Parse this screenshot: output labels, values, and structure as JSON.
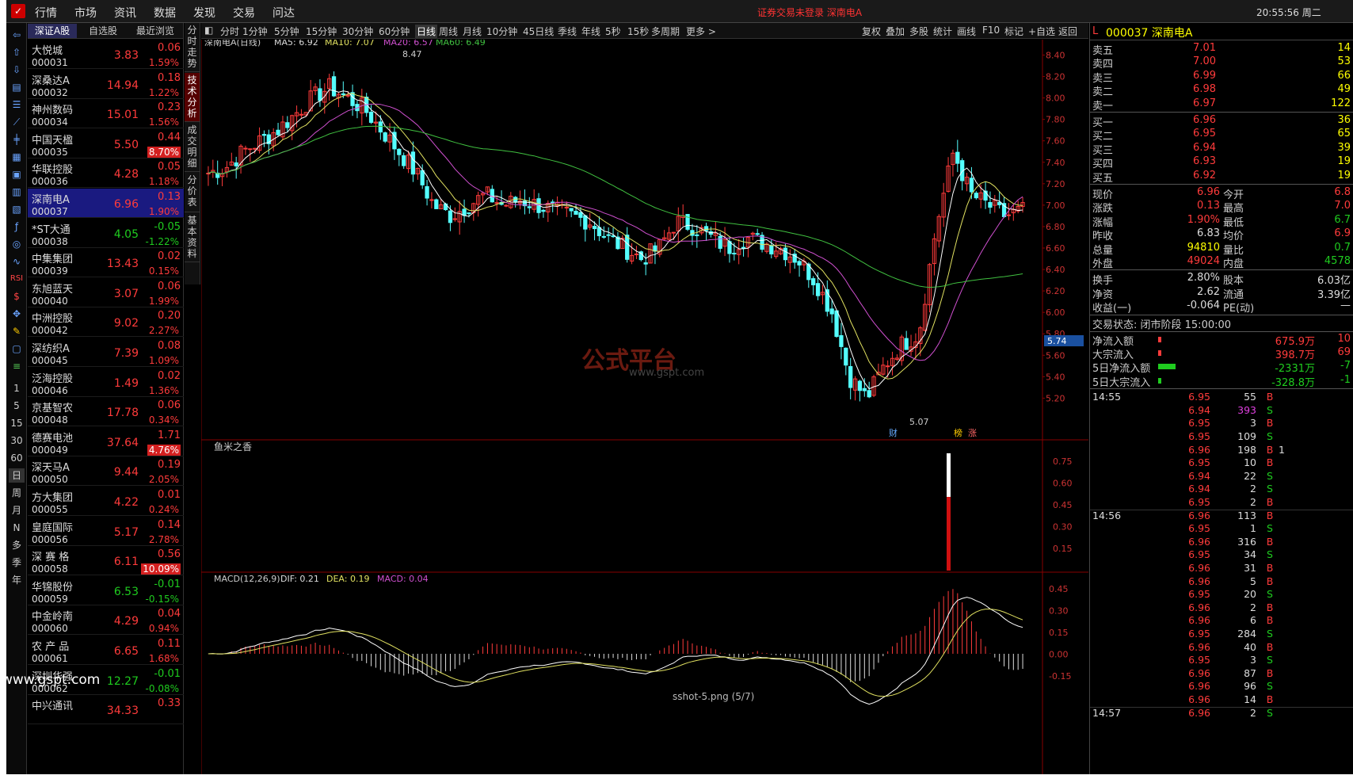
{
  "menubar": {
    "items": [
      "行情",
      "市场",
      "资讯",
      "数据",
      "发现",
      "交易",
      "问达"
    ],
    "warning": "证券交易未登录 深南电A",
    "clock": "20:55:56 周二"
  },
  "left_toolbar": {
    "periods": [
      "1",
      "5",
      "15",
      "30",
      "60",
      "日",
      "周",
      "月",
      "N",
      "多",
      "季",
      "年"
    ]
  },
  "stocklist": {
    "tabs": [
      "深证A股",
      "自选股",
      "最近浏览"
    ],
    "rows": [
      {
        "name": "大悦城",
        "code": "000031",
        "price": "3.83",
        "change": "0.06",
        "pct": "1.59%",
        "dir": "up",
        "hl": false
      },
      {
        "name": "深桑达A",
        "code": "000032",
        "price": "14.94",
        "change": "0.18",
        "pct": "1.22%",
        "dir": "up",
        "hl": false
      },
      {
        "name": "神州数码",
        "code": "000034",
        "price": "15.01",
        "change": "0.23",
        "pct": "1.56%",
        "dir": "up",
        "hl": false
      },
      {
        "name": "中国天楹",
        "code": "000035",
        "price": "5.50",
        "change": "0.44",
        "pct": "8.70%",
        "dir": "up",
        "hl": true
      },
      {
        "name": "华联控股",
        "code": "000036",
        "price": "4.28",
        "change": "0.05",
        "pct": "1.18%",
        "dir": "up",
        "hl": false
      },
      {
        "name": "深南电A",
        "code": "000037",
        "price": "6.96",
        "change": "0.13",
        "pct": "1.90%",
        "dir": "up",
        "hl": false,
        "sel": true
      },
      {
        "name": "*ST大通",
        "code": "000038",
        "price": "4.05",
        "change": "-0.05",
        "pct": "-1.22%",
        "dir": "dn",
        "hl": false
      },
      {
        "name": "中集集团",
        "code": "000039",
        "price": "13.43",
        "change": "0.02",
        "pct": "0.15%",
        "dir": "up",
        "hl": false
      },
      {
        "name": "东旭蓝天",
        "code": "000040",
        "price": "3.07",
        "change": "0.06",
        "pct": "1.99%",
        "dir": "up",
        "hl": false
      },
      {
        "name": "中洲控股",
        "code": "000042",
        "price": "9.02",
        "change": "0.20",
        "pct": "2.27%",
        "dir": "up",
        "hl": false
      },
      {
        "name": "深纺织A",
        "code": "000045",
        "price": "7.39",
        "change": "0.08",
        "pct": "1.09%",
        "dir": "up",
        "hl": false
      },
      {
        "name": "泛海控股",
        "code": "000046",
        "price": "1.49",
        "change": "0.02",
        "pct": "1.36%",
        "dir": "up",
        "hl": false
      },
      {
        "name": "京基智农",
        "code": "000048",
        "price": "17.78",
        "change": "0.06",
        "pct": "0.34%",
        "dir": "up",
        "hl": false
      },
      {
        "name": "德赛电池",
        "code": "000049",
        "price": "37.64",
        "change": "1.71",
        "pct": "4.76%",
        "dir": "up",
        "hl": true
      },
      {
        "name": "深天马A",
        "code": "000050",
        "price": "9.44",
        "change": "0.19",
        "pct": "2.05%",
        "dir": "up",
        "hl": false
      },
      {
        "name": "方大集团",
        "code": "000055",
        "price": "4.22",
        "change": "0.01",
        "pct": "0.24%",
        "dir": "up",
        "hl": false
      },
      {
        "name": "皇庭国际",
        "code": "000056",
        "price": "5.17",
        "change": "0.14",
        "pct": "2.78%",
        "dir": "up",
        "hl": false
      },
      {
        "name": "深 赛 格",
        "code": "000058",
        "price": "6.11",
        "change": "0.56",
        "pct": "10.09%",
        "dir": "up",
        "hl": true
      },
      {
        "name": "华锦股份",
        "code": "000059",
        "price": "6.53",
        "change": "-0.01",
        "pct": "-0.15%",
        "dir": "dn",
        "hl": false
      },
      {
        "name": "中金岭南",
        "code": "000060",
        "price": "4.29",
        "change": "0.04",
        "pct": "0.94%",
        "dir": "up",
        "hl": false
      },
      {
        "name": "农 产 品",
        "code": "000061",
        "price": "6.65",
        "change": "0.11",
        "pct": "1.68%",
        "dir": "up",
        "hl": false
      },
      {
        "name": "深圳华强",
        "code": "000062",
        "price": "12.27",
        "change": "-0.01",
        "pct": "-0.08%",
        "dir": "dn",
        "hl": false
      },
      {
        "name": "中兴通讯",
        "code": "",
        "price": "34.33",
        "change": "0.33",
        "pct": "",
        "dir": "up",
        "hl": false
      }
    ]
  },
  "vtabs": [
    "分时走势",
    "技术分析",
    "成交明细",
    "分价表",
    "基本资料"
  ],
  "chart_toolbar": {
    "periods": [
      "分时",
      "1分钟",
      "5分钟",
      "15分钟",
      "30分钟",
      "60分钟",
      "日线",
      "周线",
      "月线",
      "10分钟",
      "45日线",
      "季线",
      "年线",
      "5秒",
      "15秒",
      "多周期",
      "更多 >"
    ],
    "active": "日线",
    "right_buttons": [
      "复权",
      "叠加",
      "多股",
      "统计",
      "画线",
      "F10",
      "标记",
      "+自选",
      "返回"
    ]
  },
  "kline": {
    "legend_title": "深南电A(日线)",
    "ma5": "MA5: 6.92",
    "ma10": "MA10: 7.07",
    "ma20": "MA20: 6.57",
    "ma60": "MA60: 6.49",
    "high_label": "8.47",
    "low_label": "5.07",
    "price_tag": "5.74",
    "marks": [
      "财",
      "榜",
      "涨"
    ],
    "y_ticks": [
      "8.40",
      "8.20",
      "8.00",
      "7.80",
      "7.60",
      "7.40",
      "7.20",
      "7.00",
      "6.80",
      "6.60",
      "6.40",
      "6.20",
      "6.00",
      "5.80",
      "5.60",
      "5.40",
      "5.20"
    ],
    "colors": {
      "up": "#ff3b3b",
      "down": "#54ffff",
      "ma5": "#ffffff",
      "ma10": "#e0e060",
      "ma20": "#d050d0",
      "ma60": "#40c040"
    }
  },
  "indicator1": {
    "title": "鱼米之香",
    "y_ticks": [
      "0.75",
      "0.60",
      "0.45",
      "0.30",
      "0.15"
    ]
  },
  "macd": {
    "title": "MACD(12,26,9)",
    "dif": "DIF: 0.21",
    "dea": "DEA: 0.19",
    "macd": "MACD: 0.04",
    "y_ticks": [
      "0.45",
      "0.30",
      "0.15",
      "0.00",
      "-0.15"
    ]
  },
  "watermarks": {
    "logo_main": "公式平台",
    "logo_sub": "www.gspt.com",
    "caption": "sshot-5.png (5/7)",
    "left_wm": "www.gspt.com"
  },
  "quote": {
    "code": "000037",
    "name": "深南电A",
    "asks": [
      {
        "label": "卖五",
        "price": "7.01",
        "vol": "14"
      },
      {
        "label": "卖四",
        "price": "7.00",
        "vol": "53"
      },
      {
        "label": "卖三",
        "price": "6.99",
        "vol": "66"
      },
      {
        "label": "卖二",
        "price": "6.98",
        "vol": "49"
      },
      {
        "label": "卖一",
        "price": "6.97",
        "vol": "122"
      }
    ],
    "bids": [
      {
        "label": "买一",
        "price": "6.96",
        "vol": "36"
      },
      {
        "label": "买二",
        "price": "6.95",
        "vol": "65"
      },
      {
        "label": "买三",
        "price": "6.94",
        "vol": "39"
      },
      {
        "label": "买四",
        "price": "6.93",
        "vol": "19"
      },
      {
        "label": "买五",
        "price": "6.92",
        "vol": "19"
      }
    ],
    "stats": [
      {
        "k1": "现价",
        "v1": "6.96",
        "c1": "up",
        "k2": "今开",
        "v2": "6.8",
        "c2": "up"
      },
      {
        "k1": "涨跌",
        "v1": "0.13",
        "c1": "up",
        "k2": "最高",
        "v2": "7.0",
        "c2": "up"
      },
      {
        "k1": "涨幅",
        "v1": "1.90%",
        "c1": "up",
        "k2": "最低",
        "v2": "6.7",
        "c2": "dn"
      },
      {
        "k1": "昨收",
        "v1": "6.83",
        "c1": "wh",
        "k2": "均价",
        "v2": "6.9",
        "c2": "up"
      },
      {
        "k1": "总量",
        "v1": "94810",
        "c1": "yl",
        "k2": "量比",
        "v2": "0.7",
        "c2": "dn"
      },
      {
        "k1": "外盘",
        "v1": "49024",
        "c1": "up",
        "k2": "内盘",
        "v2": "4578",
        "c2": "dn"
      }
    ],
    "stats2": [
      {
        "k1": "换手",
        "v1": "2.80%",
        "k2": "股本",
        "v2": "6.03亿"
      },
      {
        "k1": "净资",
        "v1": "2.62",
        "k2": "流通",
        "v2": "3.39亿"
      },
      {
        "k1": "收益(一)",
        "v1": "-0.064",
        "k2": "PE(动)",
        "v2": "—"
      }
    ],
    "status_label": "交易状态: 闭市阶段 15:00:00",
    "flows": [
      {
        "k": "净流入额",
        "v": "675.9万",
        "v2": "10",
        "c": "up"
      },
      {
        "k": "大宗流入",
        "v": "398.7万",
        "v2": "69",
        "c": "up"
      },
      {
        "k": "5日净流入额",
        "v": "-2331万",
        "v2": "-7",
        "c": "dn"
      },
      {
        "k": "5日大宗流入",
        "v": "-328.8万",
        "v2": "-1",
        "c": "dn"
      }
    ],
    "ticks": [
      {
        "t": "14:55",
        "p": "6.95",
        "v": "55",
        "bs": "B",
        "ex": ""
      },
      {
        "t": "",
        "p": "6.94",
        "v": "393",
        "bs": "S",
        "ex": "",
        "vc": "mg"
      },
      {
        "t": "",
        "p": "6.95",
        "v": "3",
        "bs": "B",
        "ex": ""
      },
      {
        "t": "",
        "p": "6.95",
        "v": "109",
        "bs": "S",
        "ex": ""
      },
      {
        "t": "",
        "p": "6.96",
        "v": "198",
        "bs": "B",
        "ex": "1"
      },
      {
        "t": "",
        "p": "6.95",
        "v": "10",
        "bs": "B",
        "ex": ""
      },
      {
        "t": "",
        "p": "6.94",
        "v": "22",
        "bs": "S",
        "ex": ""
      },
      {
        "t": "",
        "p": "6.94",
        "v": "2",
        "bs": "S",
        "ex": ""
      },
      {
        "t": "",
        "p": "6.95",
        "v": "2",
        "bs": "B",
        "ex": ""
      },
      {
        "t": "14:56",
        "p": "6.96",
        "v": "113",
        "bs": "B",
        "ex": ""
      },
      {
        "t": "",
        "p": "6.95",
        "v": "1",
        "bs": "S",
        "ex": ""
      },
      {
        "t": "",
        "p": "6.96",
        "v": "316",
        "bs": "B",
        "ex": ""
      },
      {
        "t": "",
        "p": "6.95",
        "v": "34",
        "bs": "S",
        "ex": ""
      },
      {
        "t": "",
        "p": "6.96",
        "v": "31",
        "bs": "B",
        "ex": ""
      },
      {
        "t": "",
        "p": "6.96",
        "v": "5",
        "bs": "B",
        "ex": ""
      },
      {
        "t": "",
        "p": "6.95",
        "v": "20",
        "bs": "S",
        "ex": ""
      },
      {
        "t": "",
        "p": "6.96",
        "v": "2",
        "bs": "B",
        "ex": ""
      },
      {
        "t": "",
        "p": "6.96",
        "v": "6",
        "bs": "B",
        "ex": ""
      },
      {
        "t": "",
        "p": "6.95",
        "v": "284",
        "bs": "S",
        "ex": ""
      },
      {
        "t": "",
        "p": "6.96",
        "v": "40",
        "bs": "B",
        "ex": ""
      },
      {
        "t": "",
        "p": "6.95",
        "v": "3",
        "bs": "S",
        "ex": ""
      },
      {
        "t": "",
        "p": "6.96",
        "v": "87",
        "bs": "B",
        "ex": ""
      },
      {
        "t": "",
        "p": "6.96",
        "v": "96",
        "bs": "S",
        "ex": ""
      },
      {
        "t": "",
        "p": "6.96",
        "v": "14",
        "bs": "B",
        "ex": ""
      },
      {
        "t": "14:57",
        "p": "6.96",
        "v": "2",
        "bs": "S",
        "ex": ""
      }
    ]
  }
}
